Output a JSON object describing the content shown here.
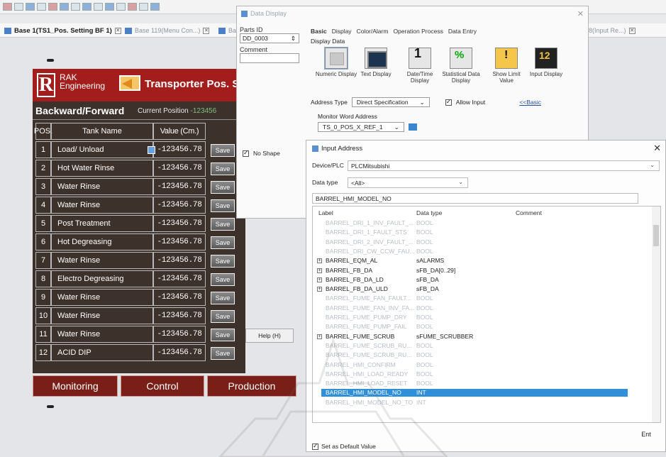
{
  "tabs": [
    {
      "label": "Base 1(TS1_Pos. Setting BF 1)"
    },
    {
      "label": "Base 119(Menu Con...)"
    },
    {
      "label": "Ba"
    },
    {
      "label": "8(Input Re...)"
    }
  ],
  "hmi": {
    "brand_line1": "RAK",
    "brand_line2": "Engineering",
    "title": "Transporter Pos. S",
    "section": "Backward/Forward",
    "current_label": "Current Position",
    "current_value": "-123456",
    "headers": {
      "pos": "POS.",
      "name": "Tank Name",
      "value": "Value (Cm.)"
    },
    "save_label": "Save",
    "rows": [
      {
        "pos": "1",
        "name": "Load/ Unload",
        "value": "-123456.78"
      },
      {
        "pos": "2",
        "name": "Hot Water Rinse",
        "value": "-123456.78"
      },
      {
        "pos": "3",
        "name": "Water Rinse",
        "value": "-123456.78"
      },
      {
        "pos": "4",
        "name": "Water Rinse",
        "value": "-123456.78"
      },
      {
        "pos": "5",
        "name": "Post Treatment",
        "value": "-123456.78"
      },
      {
        "pos": "6",
        "name": "Hot Degreasing",
        "value": "-123456.78"
      },
      {
        "pos": "7",
        "name": "Water Rinse",
        "value": "-123456.78"
      },
      {
        "pos": "8",
        "name": "Electro Degreasing",
        "value": "-123456.78"
      },
      {
        "pos": "9",
        "name": "Water Rinse",
        "value": "-123456.78"
      },
      {
        "pos": "10",
        "name": "Water Rinse",
        "value": "-123456.78"
      },
      {
        "pos": "11",
        "name": "Water Rinse",
        "value": "-123456.78"
      },
      {
        "pos": "12",
        "name": "ACID DIP",
        "value": "-123456.78"
      }
    ],
    "nav": [
      "Monitoring",
      "Control",
      "Production"
    ]
  },
  "data_display": {
    "title": "Data Display",
    "parts_id_label": "Parts ID",
    "parts_id_value": "DD_0003",
    "comment_label": "Comment",
    "tabs": [
      "Basic",
      "Display",
      "Color/Alarm",
      "Operation Process",
      "Data Entry"
    ],
    "display_data_label": "Display Data",
    "icons": [
      {
        "label": "Numeric Display",
        "icon": "numeric-display-icon"
      },
      {
        "label": "Text Display",
        "icon": "text-display-icon"
      },
      {
        "label": "Date/Time Display",
        "icon": "datetime-display-icon"
      },
      {
        "label": "Statistical Data Display",
        "icon": "statistical-display-icon"
      },
      {
        "label": "Show Limit Value",
        "icon": "limit-warning-icon"
      },
      {
        "label": "Input Display",
        "icon": "input-display-icon"
      }
    ],
    "address_type_label": "Address Type",
    "address_type_value": "Direct Specification",
    "allow_input_label": "Allow Input",
    "basic_link": "<<Basic",
    "monitor_label": "Monitor Word Address",
    "monitor_value": "TS_0_POS_X_REF_1",
    "no_shape_label": "No Shape",
    "help_label": "Help (H)"
  },
  "input_address": {
    "title": "Input Address",
    "device_label": "Device/PLC",
    "device_value": "PLCMitsubishi",
    "datatype_label": "Data type",
    "datatype_value": "<All>",
    "search_value": "BARREL_HMI_MODEL_NO",
    "columns": {
      "label": "Label",
      "type": "Data type",
      "comment": "Comment"
    },
    "items": [
      {
        "name": "BARREL_DRI_1_INV_FAULT_...",
        "type": "BOOL",
        "style": "dim"
      },
      {
        "name": "BARREL_DRI_1_FAULT_STS",
        "type": "BOOL",
        "style": "dim"
      },
      {
        "name": "BARREL_DRI_2_INV_FAULT_...",
        "type": "BOOL",
        "style": "dim"
      },
      {
        "name": "BARREL_DRI_CW_CCW_FAU...",
        "type": "BOOL",
        "style": "dim"
      },
      {
        "name": "BARREL_EQM_AL",
        "type": "sALARMS",
        "style": "dark",
        "exp": true
      },
      {
        "name": "BARREL_FB_DA",
        "type": "sFB_DA[0..29]",
        "style": "dark",
        "exp": true
      },
      {
        "name": "BARREL_FB_DA_LD",
        "type": "sFB_DA",
        "style": "dark",
        "exp": true
      },
      {
        "name": "BARREL_FB_DA_ULD",
        "type": "sFB_DA",
        "style": "dark",
        "exp": true
      },
      {
        "name": "BARREL_FUME_FAN_FAULT...",
        "type": "BOOL",
        "style": "dim"
      },
      {
        "name": "BARREL_FUME_FAN_INV_FA...",
        "type": "BOOL",
        "style": "dim"
      },
      {
        "name": "BARREL_FUME_PUMP_DRY",
        "type": "BOOL",
        "style": "dim"
      },
      {
        "name": "BARREL_FUME_PUMP_FAIL",
        "type": "BOOL",
        "style": "dim"
      },
      {
        "name": "BARREL_FUME_SCRUB",
        "type": "sFUME_SCRUBBER",
        "style": "dark",
        "exp": true
      },
      {
        "name": "BARREL_FUME_SCRUB_RU...",
        "type": "BOOL",
        "style": "dim"
      },
      {
        "name": "BARREL_FUME_SCRUB_RU...",
        "type": "BOOL",
        "style": "dim"
      },
      {
        "name": "BARREL_HMI_CONFIRM",
        "type": "BOOL",
        "style": "dim"
      },
      {
        "name": "BARREL_HMI_LOAD_READY",
        "type": "BOOL",
        "style": "dim"
      },
      {
        "name": "BARREL_HMI_LOAD_RESET",
        "type": "BOOL",
        "style": "dim"
      },
      {
        "name": "BARREL_HMI_MODEL_NO",
        "type": "INT",
        "style": "hl"
      },
      {
        "name": "BARREL_HMI_MODEL_NO_TO",
        "type": "INT",
        "style": "dim"
      }
    ],
    "ent_label": "Ent",
    "default_label": "Set as Default Value"
  }
}
